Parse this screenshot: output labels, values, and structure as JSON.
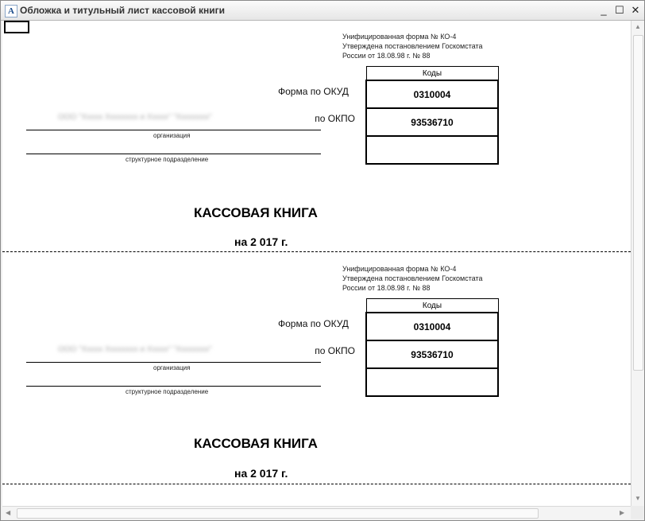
{
  "window": {
    "title": "Обложка и титульный лист кассовой книги",
    "icon": "report-icon",
    "buttons": {
      "minimize": "_",
      "maximize": "☐",
      "close": "✕"
    }
  },
  "pages": [
    {
      "unified_form": [
        "Унифицированная форма № КО-4",
        "Утверждена постановлением Госкомстата",
        "России от 18.08.98 г. № 88"
      ],
      "codes_header": "Коды",
      "okud_label": "Форма по ОКУД",
      "okud_value": "0310004",
      "okpo_label": "по ОКПО",
      "okpo_value": "93536710",
      "organization_caption": "организация",
      "subdivision_caption": "структурное подразделение",
      "book_title": "КАССОВАЯ КНИГА",
      "book_year": "на 2 017 г."
    },
    {
      "unified_form": [
        "Унифицированная форма № КО-4",
        "Утверждена постановлением Госкомстата",
        "России от 18.08.98 г. № 88"
      ],
      "codes_header": "Коды",
      "okud_label": "Форма по ОКУД",
      "okud_value": "0310004",
      "okpo_label": "по ОКПО",
      "okpo_value": "93536710",
      "organization_caption": "организация",
      "subdivision_caption": "структурное подразделение",
      "book_title": "КАССОВАЯ КНИГА",
      "book_year": "на 2 017 г."
    }
  ]
}
